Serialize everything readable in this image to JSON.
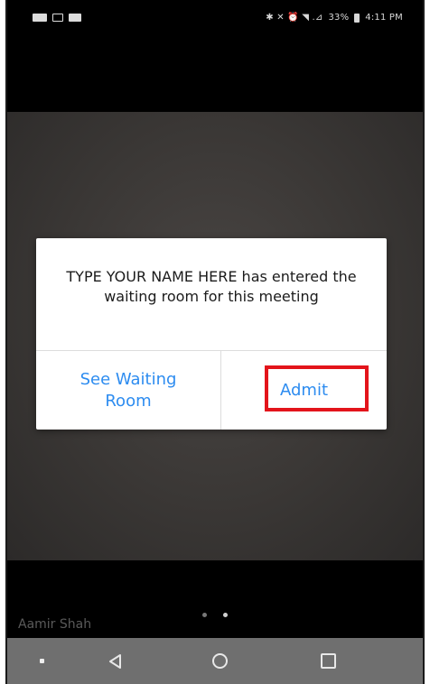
{
  "status_bar": {
    "indicators": "✱ ✕ ⏰ ◥ .⊿",
    "battery": "33%",
    "time": "4:11 PM",
    "left_icons": [
      "message-icon",
      "mail-icon",
      "video-icon"
    ]
  },
  "dialog": {
    "message": "TYPE YOUR NAME HERE has entered the waiting room for this meeting",
    "see_waiting_room": "See Waiting Room",
    "admit": "Admit"
  },
  "participant": {
    "name": "Aamir Shah"
  },
  "pager": {
    "page_count": 2,
    "active_index": 1
  },
  "colors": {
    "link_blue": "#2d8cf0",
    "highlight_red": "#e3141b",
    "nav_bar": "#6f6f6f"
  }
}
